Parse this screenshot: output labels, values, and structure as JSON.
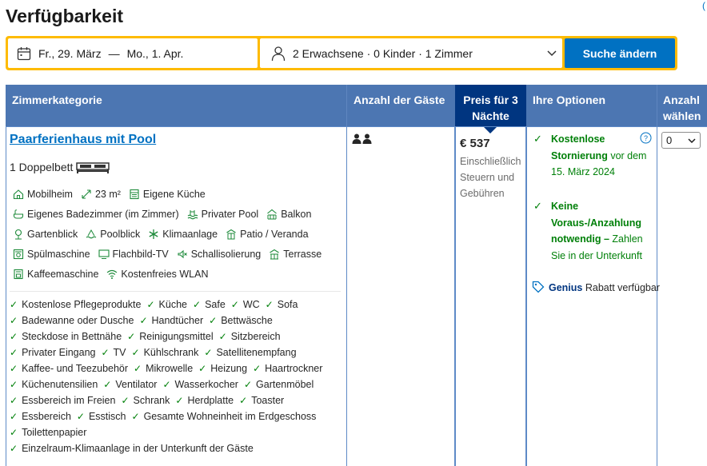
{
  "page": {
    "title": "Verfügbarkeit",
    "corner_mark": "("
  },
  "search": {
    "checkin": "Fr., 29. März",
    "separator": "—",
    "checkout": "Mo., 1. Apr.",
    "guests": "2 Erwachsene · 0 Kinder · 1 Zimmer",
    "button": "Suche ändern"
  },
  "table": {
    "headers": {
      "room_type": "Zimmerkategorie",
      "guests": "Anzahl der Gäste",
      "price_line1": "Preis für 3",
      "price_line2": "Nächte",
      "options": "Ihre Optionen",
      "select_line1": "Anzahl",
      "select_line2": "wählen"
    }
  },
  "room": {
    "name": "Paarferienhaus mit Pool",
    "bed": "1 Doppelbett",
    "facilities_rows": [
      [
        {
          "icon": "house-icon",
          "label": "Mobilheim"
        },
        {
          "icon": "size-icon",
          "label": "23 m²"
        },
        {
          "icon": "kitchen-icon",
          "label": "Eigene Küche"
        }
      ],
      [
        {
          "icon": "bath-icon",
          "label": "Eigenes Badezimmer (im Zimmer)"
        },
        {
          "icon": "pool-icon",
          "label": "Privater Pool"
        },
        {
          "icon": "balcony-icon",
          "label": "Balkon"
        }
      ],
      [
        {
          "icon": "garden-icon",
          "label": "Gartenblick"
        },
        {
          "icon": "poolview-icon",
          "label": "Poolblick"
        },
        {
          "icon": "snowflake-icon",
          "label": "Klimaanlage"
        },
        {
          "icon": "patio-icon",
          "label": "Patio / Veranda"
        }
      ],
      [
        {
          "icon": "dishwasher-icon",
          "label": "Spülmaschine"
        },
        {
          "icon": "tv-icon",
          "label": "Flachbild-TV"
        },
        {
          "icon": "soundproof-icon",
          "label": "Schallisolierung"
        },
        {
          "icon": "terrace-icon",
          "label": "Terrasse"
        }
      ],
      [
        {
          "icon": "coffee-machine-icon",
          "label": "Kaffeemaschine"
        },
        {
          "icon": "wifi-icon",
          "label": "Kostenfreies WLAN"
        }
      ]
    ],
    "amenities_rows": [
      [
        "Kostenlose Pflegeprodukte",
        "Küche",
        "Safe",
        "WC",
        "Sofa"
      ],
      [
        "Badewanne oder Dusche",
        "Handtücher",
        "Bettwäsche"
      ],
      [
        "Steckdose in Bettnähe",
        "Reinigungsmittel",
        "Sitzbereich"
      ],
      [
        "Privater Eingang",
        "TV",
        "Kühlschrank",
        "Satellitenempfang"
      ],
      [
        "Kaffee- und Teezubehör",
        "Mikrowelle",
        "Heizung",
        "Haartrockner"
      ],
      [
        "Küchenutensilien",
        "Ventilator",
        "Wasserkocher",
        "Gartenmöbel"
      ],
      [
        "Essbereich im Freien",
        "Schrank",
        "Herdplatte",
        "Toaster"
      ],
      [
        "Essbereich",
        "Esstisch",
        "Gesamte Wohneinheit im Erdgeschoss"
      ],
      [
        "Toilettenpapier"
      ],
      [
        "Einzelraum-Klimaanlage in der Unterkunft der Gäste"
      ]
    ],
    "guest_count": 2,
    "price": "€ 537",
    "price_note": "Einschließlich Steuern und Gebühren",
    "options": {
      "cancel_bold": "Kostenlose Stornierung",
      "cancel_rest": " vor dem 15. März 2024",
      "prepay_bold": "Keine Voraus-/Anzahlung notwendig –",
      "prepay_rest": " Zahlen Sie in der Unterkunft",
      "genius_brand": "Genius",
      "genius_text": " Rabatt verfügbar"
    },
    "select_value": "0"
  },
  "colors": {
    "header": "#4c76b2",
    "price_header": "#003580",
    "link": "#0071c2",
    "green": "#008009",
    "search_border": "#febb02"
  }
}
